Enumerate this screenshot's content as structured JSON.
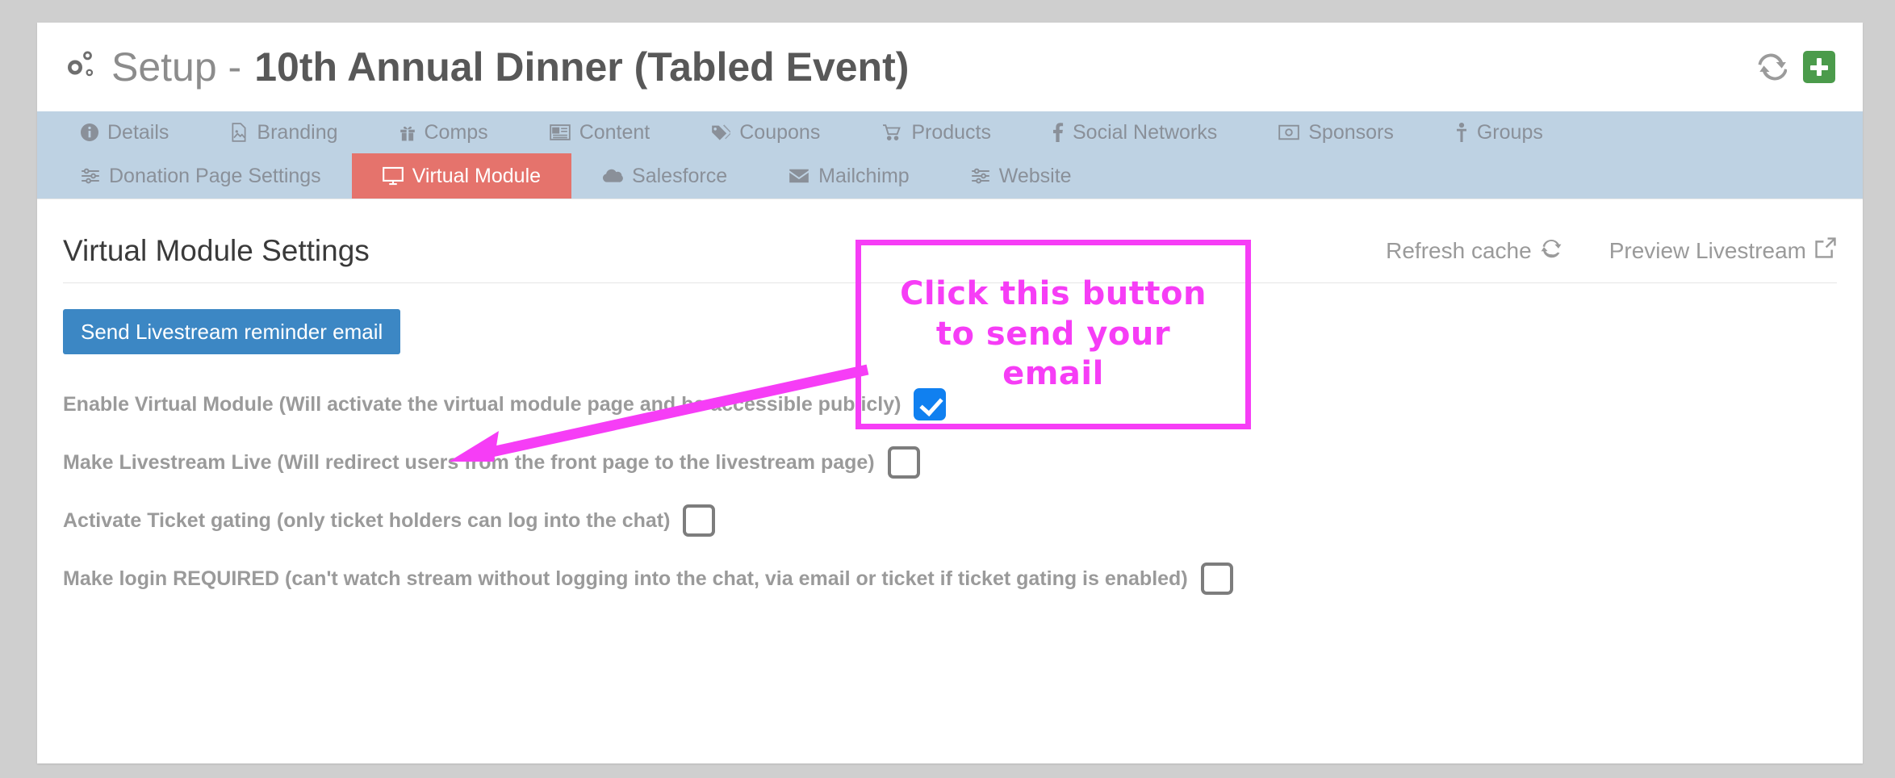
{
  "header": {
    "title_prefix": "Setup -",
    "title_event": "10th Annual Dinner (Tabled Event)",
    "gears_icon": "gears-icon",
    "refresh_icon": "refresh-icon",
    "add_icon": "plus-icon"
  },
  "tabs_row1": [
    {
      "label": "Details",
      "icon": "info-circle-icon",
      "active": false
    },
    {
      "label": "Branding",
      "icon": "image-file-icon",
      "active": false
    },
    {
      "label": "Comps",
      "icon": "gift-icon",
      "active": false
    },
    {
      "label": "Content",
      "icon": "newspaper-icon",
      "active": false
    },
    {
      "label": "Coupons",
      "icon": "tag-icon",
      "active": false
    },
    {
      "label": "Products",
      "icon": "shopping-cart-icon",
      "active": false
    },
    {
      "label": "Social Networks",
      "icon": "facebook-f-icon",
      "active": false
    },
    {
      "label": "Sponsors",
      "icon": "money-bill-icon",
      "active": false
    },
    {
      "label": "Groups",
      "icon": "person-icon",
      "active": false
    }
  ],
  "tabs_row2": [
    {
      "label": "Donation Page Settings",
      "icon": "sliders-icon",
      "active": false
    },
    {
      "label": "Virtual Module",
      "icon": "monitor-icon",
      "active": true
    },
    {
      "label": "Salesforce",
      "icon": "cloud-icon",
      "active": false
    },
    {
      "label": "Mailchimp",
      "icon": "envelope-icon",
      "active": false
    },
    {
      "label": "Website",
      "icon": "sliders-icon",
      "active": false
    }
  ],
  "section": {
    "title": "Virtual Module Settings",
    "refresh_cache_label": "Refresh cache",
    "refresh_cache_icon": "refresh-icon",
    "preview_livestream_label": "Preview Livestream",
    "preview_livestream_icon": "external-link-icon"
  },
  "primary_button": {
    "label": "Send Livestream reminder email",
    "color": "#3c87c4"
  },
  "settings": [
    {
      "label": "Enable Virtual Module (Will activate the virtual module page and be accessible publicly)",
      "checked": true
    },
    {
      "label": "Make Livestream Live (Will redirect users from the front page to the livestream page)",
      "checked": false
    },
    {
      "label": "Activate Ticket gating (only ticket holders can log into the chat)",
      "checked": false
    },
    {
      "label": "Make login REQUIRED (can't watch stream without logging into the chat, via email or ticket if ticket gating is enabled)",
      "checked": false
    }
  ],
  "annotation": {
    "line1": "Click this button",
    "line2": "to send your",
    "line3": "email",
    "color": "#f63df6"
  },
  "colors": {
    "active_tab": "#e5736c",
    "tabbar": "#bed2e3",
    "checkbox_checked": "#1080f0",
    "add_button": "#4b9b4b"
  }
}
